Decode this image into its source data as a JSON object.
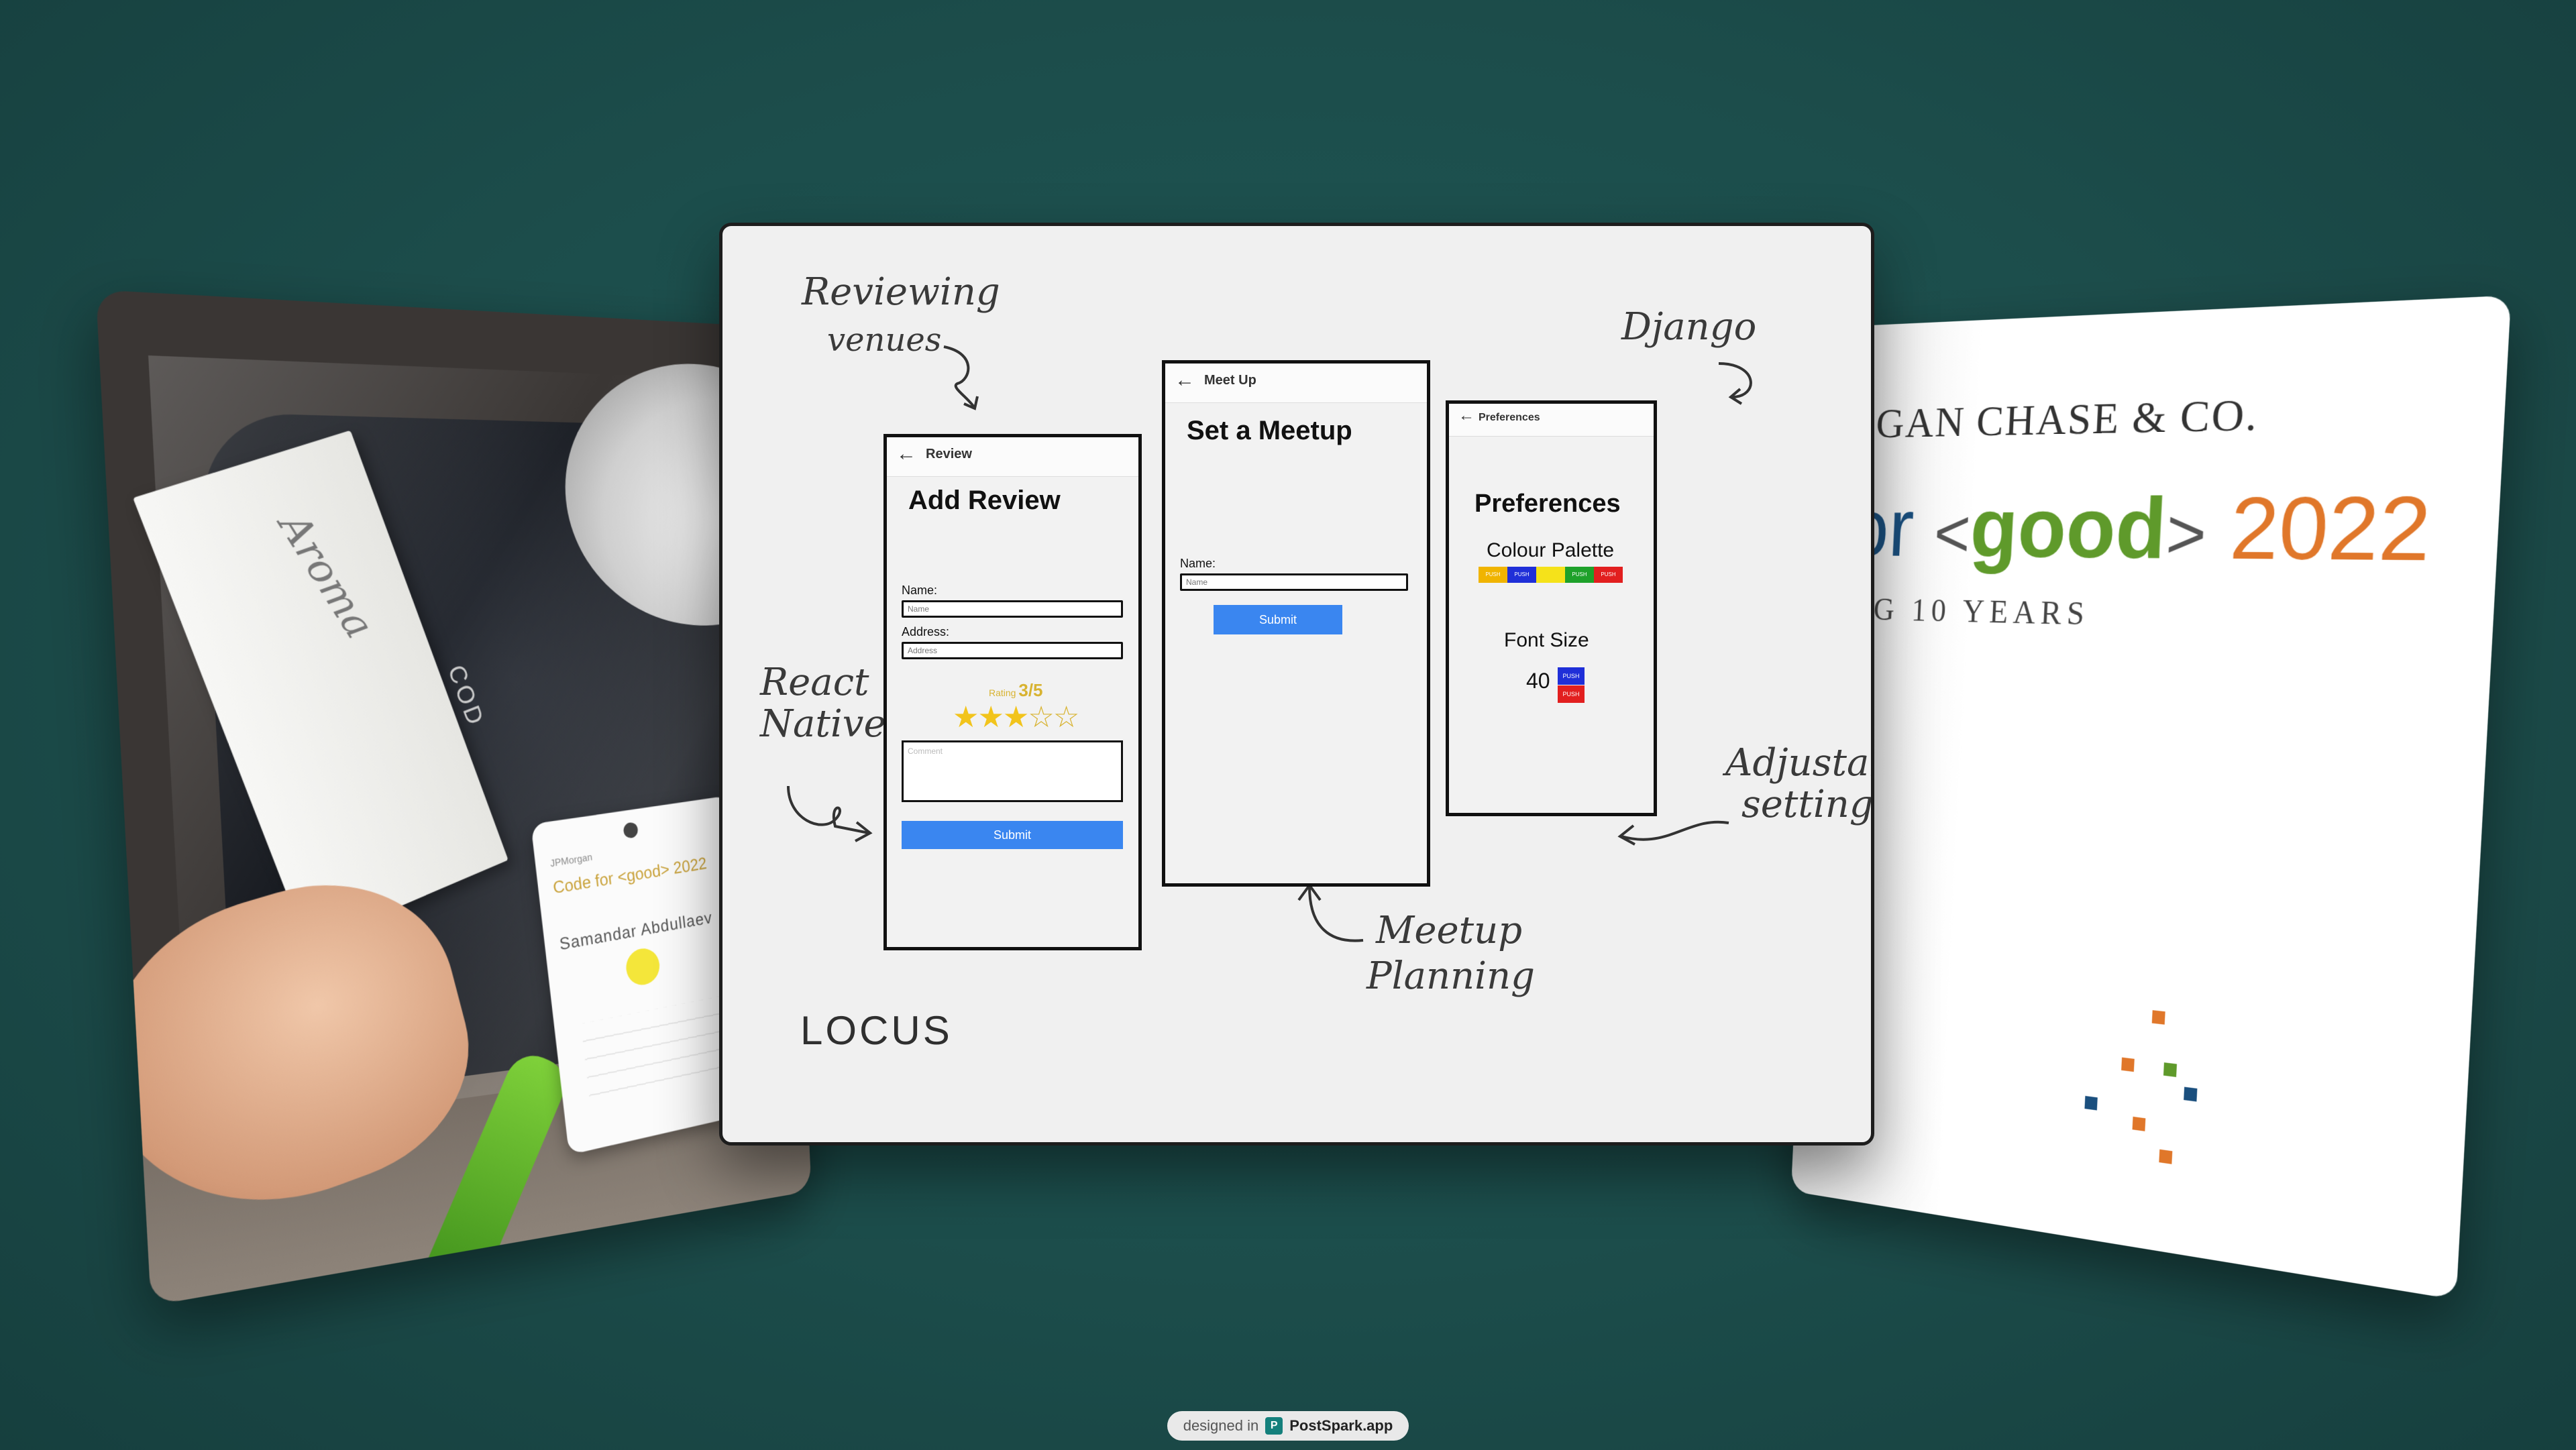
{
  "left_card": {
    "box_brand": "Aroma",
    "box_side": "COD",
    "badge_line1": "JPMorgan",
    "badge_line2": "Code for <good> 2022",
    "badge_name": "Samandar Abdullaev"
  },
  "right_card": {
    "company": "GAN CHASE & CO.",
    "tagline_for": "for",
    "tagline_open": "<",
    "tagline_good": "good",
    "tagline_close": ">",
    "tagline_year": "2022",
    "years": "G 10 YEARS"
  },
  "center_card": {
    "notes": {
      "reviewing_venues": [
        "Reviewing",
        "venues"
      ],
      "django": "Django",
      "react_native": [
        "React",
        "Native"
      ],
      "adjustable_settings": [
        "Adjustable",
        "settings"
      ],
      "meetup_planning": [
        "Meetup",
        "Planning"
      ]
    },
    "brand": "LOCUS",
    "review_screen": {
      "back_icon": "←",
      "header": "Review",
      "title": "Add Review",
      "name_label": "Name:",
      "name_placeholder": "Name",
      "address_label": "Address:",
      "address_placeholder": "Address",
      "rating_label": "Rating ",
      "rating_value": "3/5",
      "rating": 3,
      "rating_max": 5,
      "comment_placeholder": "Comment",
      "submit": "Submit"
    },
    "meetup_screen": {
      "back_icon": "←",
      "header": "Meet Up",
      "title": "Set a Meetup",
      "name_label": "Name:",
      "name_placeholder": "Name",
      "submit": "Submit"
    },
    "preferences_screen": {
      "back_icon": "←",
      "header": "Preferences",
      "title": "Preferences",
      "palette_label": "Colour Palette",
      "swatches": [
        {
          "label": "PUSH",
          "color": "#f0b400"
        },
        {
          "label": "PUSH",
          "color": "#1f2fd8"
        },
        {
          "label": "",
          "color": "#f5e21a"
        },
        {
          "label": "PUSH",
          "color": "#1ea12a"
        },
        {
          "label": "PUSH",
          "color": "#e21f1f"
        }
      ],
      "font_size_label": "Font Size",
      "font_size_value": "40",
      "push_up": {
        "label": "PUSH",
        "color": "#1f2fd8"
      },
      "push_down": {
        "label": "PUSH",
        "color": "#e21f1f"
      }
    }
  },
  "footer": {
    "prefix": "designed in",
    "logo": "P",
    "brand": "PostSpark.app"
  }
}
